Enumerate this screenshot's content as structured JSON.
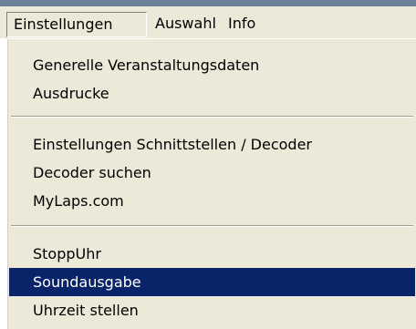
{
  "menubar": {
    "items": [
      {
        "label": "Einstellungen"
      },
      {
        "label": "Auswahl"
      },
      {
        "label": "Info"
      }
    ]
  },
  "dropdown": {
    "groups": [
      [
        "Generelle Veranstaltungsdaten",
        "Ausdrucke"
      ],
      [
        "Einstellungen Schnittstellen / Decoder",
        "Decoder suchen",
        "MyLaps.com"
      ],
      [
        "StoppUhr",
        "Soundausgabe",
        "Uhrzeit stellen"
      ]
    ],
    "highlighted_item": "Soundausgabe"
  }
}
